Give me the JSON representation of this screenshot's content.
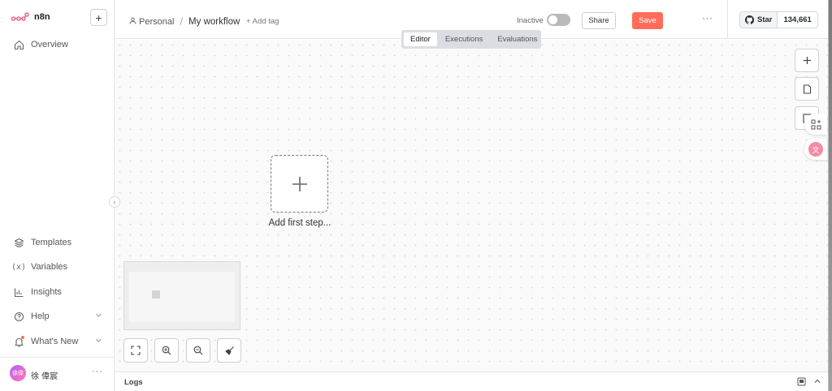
{
  "app": {
    "name": "n8n",
    "accent": "#ff6d5a"
  },
  "sidebar": {
    "top_items": [
      {
        "label": "Overview",
        "icon": "home-icon"
      }
    ],
    "bottom_items": [
      {
        "label": "Templates",
        "icon": "box-icon"
      },
      {
        "label": "Variables",
        "icon": "variable-icon"
      },
      {
        "label": "Insights",
        "icon": "chart-icon"
      },
      {
        "label": "Help",
        "icon": "help-icon"
      },
      {
        "label": "What's New",
        "icon": "bell-icon"
      }
    ],
    "user": {
      "name": "徐 偉宸",
      "initials": "徐偉"
    },
    "more": "···"
  },
  "header": {
    "project": "Personal",
    "separator": "/",
    "workflow_name": "My workflow",
    "add_tag": "+ Add tag",
    "status": "Inactive",
    "share_label": "Share",
    "save_label": "Save",
    "more": "···",
    "github": {
      "star_label": "Star",
      "count": "134,661"
    }
  },
  "tabs": [
    {
      "label": "Editor",
      "active": true
    },
    {
      "label": "Executions",
      "active": false
    },
    {
      "label": "Evaluations",
      "active": false
    }
  ],
  "canvas": {
    "add_first_step": "Add first step..."
  },
  "logs": {
    "label": "Logs"
  }
}
